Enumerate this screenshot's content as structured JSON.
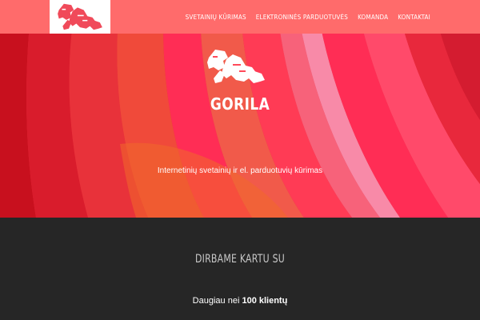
{
  "header": {
    "logo_icon": "gorilla-logo-icon",
    "nav": [
      {
        "label": "SVETAINIŲ KŪRIMAS"
      },
      {
        "label": "ELEKTRONINĖS PARDUOTUVĖS"
      },
      {
        "label": "KOMANDA"
      },
      {
        "label": "KONTAKTAI"
      }
    ],
    "bar_color": "#ff6b6b"
  },
  "hero": {
    "logo_icon": "gorilla-logo-icon",
    "brand": "GORILA",
    "tagline": "Internetinių svetainių ir el. parduotuvių kūrimas"
  },
  "partners": {
    "heading": "DIRBAME KARTU SU",
    "clients_prefix": "Daugiau nei",
    "clients_count": "100 klientų"
  }
}
